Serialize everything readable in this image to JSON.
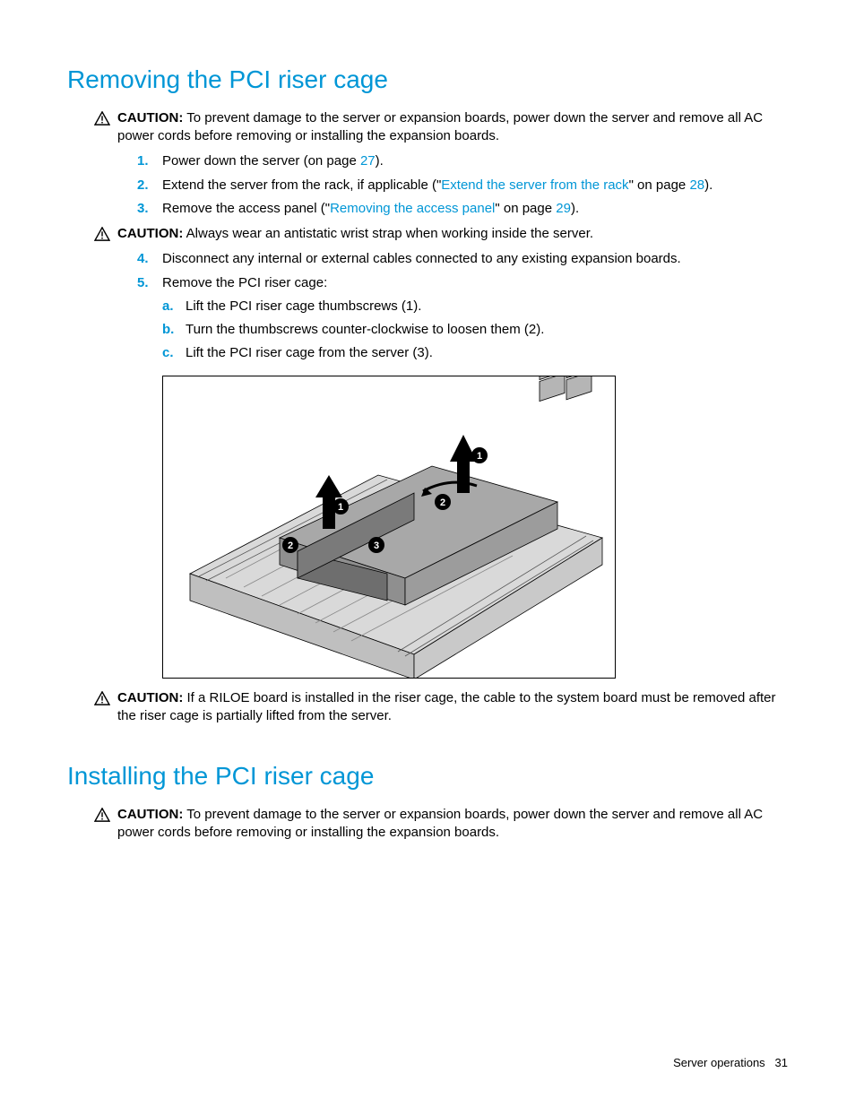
{
  "section1": {
    "heading": "Removing the PCI riser cage",
    "caution1_label": "CAUTION:",
    "caution1_text": "To prevent damage to the server or expansion boards, power down the server and remove all AC power cords before removing or installing the expansion boards.",
    "steps": [
      {
        "marker": "1.",
        "before": "Power down the server (on page ",
        "link": "27",
        "after": ")."
      },
      {
        "marker": "2.",
        "before": "Extend the server from the rack, if applicable (\"",
        "link": "Extend the server from the rack",
        "mid": "\" on page ",
        "link2": "28",
        "after": ")."
      },
      {
        "marker": "3.",
        "before": "Remove the access panel (\"",
        "link": "Removing the access panel",
        "mid": "\" on page ",
        "link2": "29",
        "after": ")."
      }
    ],
    "caution2_label": "CAUTION:",
    "caution2_text": "Always wear an antistatic wrist strap when working inside the server.",
    "steps2": [
      {
        "marker": "4.",
        "text": "Disconnect any internal or external cables connected to any existing expansion boards."
      },
      {
        "marker": "5.",
        "text": "Remove the PCI riser cage:",
        "sub": [
          {
            "marker": "a.",
            "text": "Lift the PCI riser cage thumbscrews (1)."
          },
          {
            "marker": "b.",
            "text": "Turn the thumbscrews counter-clockwise to loosen them (2)."
          },
          {
            "marker": "c.",
            "text": "Lift the PCI riser cage from the server (3)."
          }
        ]
      }
    ],
    "caution3_label": "CAUTION:",
    "caution3_text": "If a RILOE board is installed in the riser cage, the cable to the system board must be removed after the riser cage is partially lifted from the server."
  },
  "section2": {
    "heading": "Installing the PCI riser cage",
    "caution1_label": "CAUTION:",
    "caution1_text": "To prevent damage to the server or expansion boards, power down the server and remove all AC power cords before removing or installing the expansion boards."
  },
  "footer": {
    "section": "Server operations",
    "page": "31"
  },
  "callouts": {
    "c1": "1",
    "c2": "2",
    "c3": "3"
  }
}
